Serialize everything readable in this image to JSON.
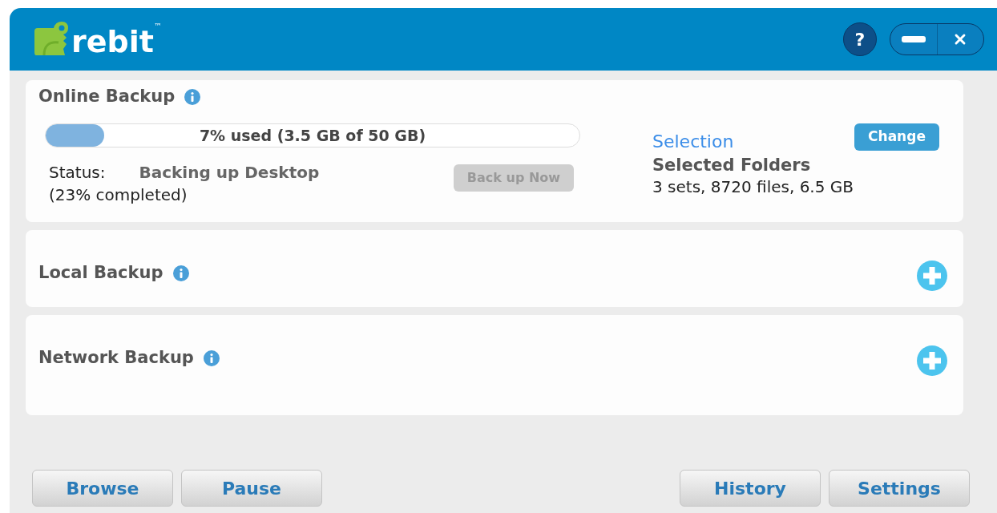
{
  "header": {
    "logo": "rebit",
    "trademark": "™",
    "help": "?"
  },
  "sections": [
    {
      "title": "Online Backup",
      "expanded": true,
      "usage": {
        "level": 0.11,
        "reading": "7% used (3.5 GB of 50 GB)"
      },
      "status_label": "Status:",
      "status_value": "Backing up Desktop",
      "progress": "(23% completed)",
      "backup_button": {
        "label": "Back up Now",
        "disabled": true
      },
      "selection_link": "Selection",
      "selection_name": "Selected Folders",
      "selection_summary": "3 sets, 8720 files, 6.5 GB",
      "change_button": "Change"
    },
    {
      "title": "Local Backup",
      "expanded": false
    },
    {
      "title": "Network Backup",
      "expanded": false
    }
  ],
  "footer_left": [
    "Browse",
    "Pause"
  ],
  "footer_right": [
    "History",
    "Settings"
  ]
}
